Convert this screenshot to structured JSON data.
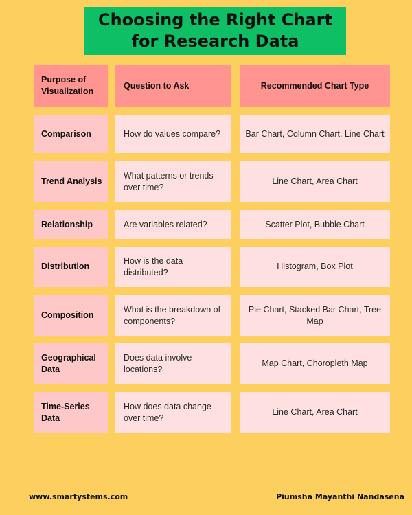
{
  "title": {
    "line1": "Choosing the Right Chart",
    "line2": "for Research Data"
  },
  "colors": {
    "background": "#fdcf5f",
    "title_bg": "#0fbf66",
    "header_bg": "#ff9491",
    "purpose_bg": "#ffc8c8",
    "cell_bg": "#ffe0e0"
  },
  "table": {
    "headers": [
      "Purpose of Visualization",
      "Question to Ask",
      "Recommended Chart Type"
    ],
    "rows": [
      {
        "purpose": "Comparison",
        "question": "How do values compare?",
        "chart": "Bar Chart, Column Chart, Line Chart"
      },
      {
        "purpose": "Trend Analysis",
        "question": "What patterns or trends over time?",
        "chart": "Line Chart, Area Chart"
      },
      {
        "purpose": "Relationship",
        "question": "Are variables related?",
        "chart": "Scatter Plot, Bubble Chart"
      },
      {
        "purpose": "Distribution",
        "question": "How is the data distributed?",
        "chart": "Histogram, Box Plot"
      },
      {
        "purpose": "Composition",
        "question": "What is the breakdown of components?",
        "chart": "Pie Chart, Stacked Bar Chart, Tree Map"
      },
      {
        "purpose": "Geographical Data",
        "question": "Does data involve locations?",
        "chart": "Map Chart, Choropleth Map"
      },
      {
        "purpose": "Time-Series Data",
        "question": "How does data change over time?",
        "chart": "Line Chart, Area Chart"
      }
    ]
  },
  "footer": {
    "website": "www.smartystems.com",
    "author": "Piumsha Mayanthi Nandasena"
  }
}
